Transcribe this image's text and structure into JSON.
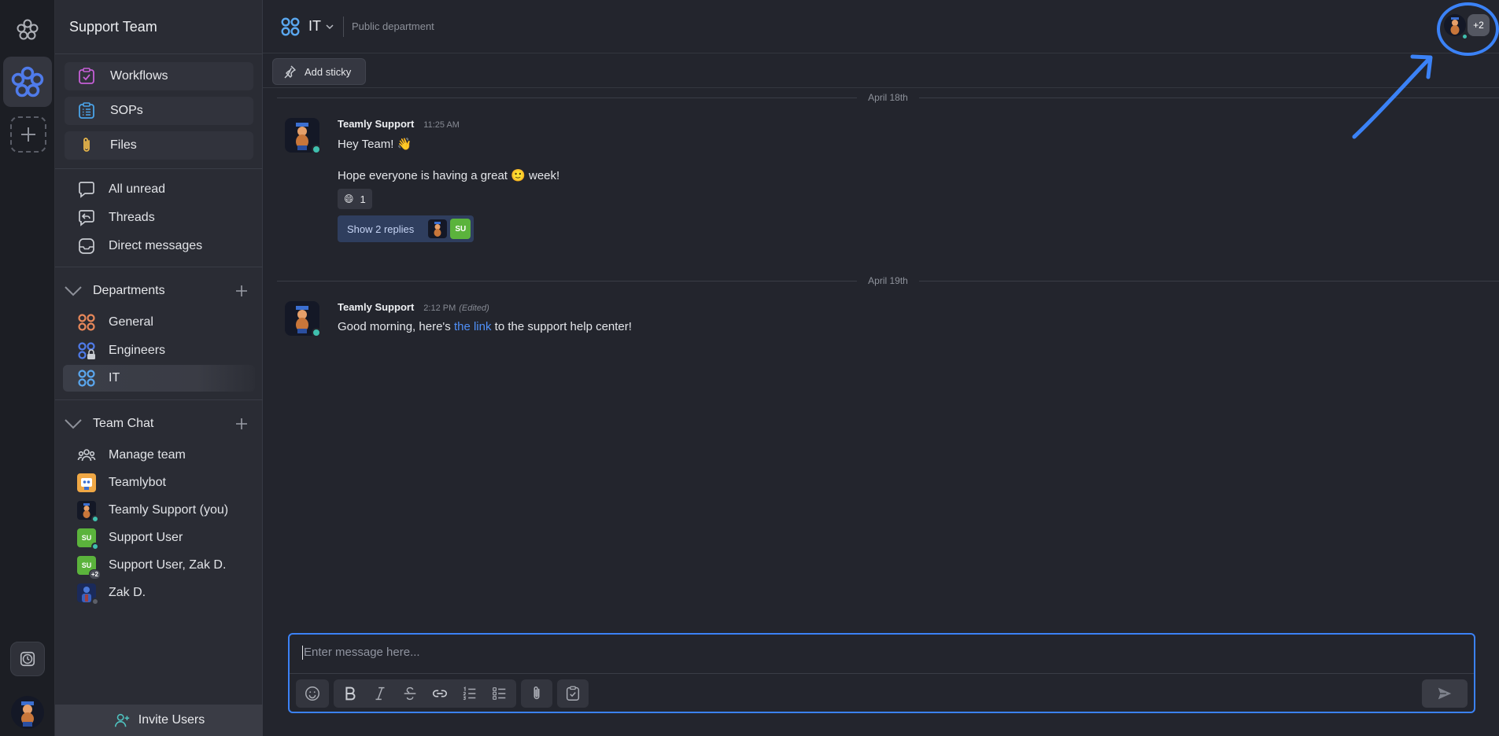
{
  "workspace": {
    "team_name": "Support Team"
  },
  "sidebar": {
    "cards": [
      {
        "label": "Workflows",
        "icon": "workflow-icon"
      },
      {
        "label": "SOPs",
        "icon": "checklist-icon"
      },
      {
        "label": "Files",
        "icon": "paperclip-icon"
      }
    ],
    "nav": [
      {
        "label": "All unread",
        "icon": "chat-bubble-icon"
      },
      {
        "label": "Threads",
        "icon": "thread-icon"
      },
      {
        "label": "Direct messages",
        "icon": "inbox-icon"
      }
    ],
    "departments": {
      "title": "Departments",
      "items": [
        {
          "label": "General",
          "color": "#e8885a"
        },
        {
          "label": "Engineers",
          "color": "#4f7bea"
        },
        {
          "label": "IT",
          "color": "#5aa8f0",
          "active": true
        }
      ]
    },
    "team_chat": {
      "title": "Team Chat",
      "items": [
        {
          "label": "Manage team"
        },
        {
          "label": "Teamlybot"
        },
        {
          "label": "Teamly Support (you)"
        },
        {
          "label": "Support User",
          "initials": "SU"
        },
        {
          "label": "Support User, Zak D.",
          "initials": "SU",
          "badge": "+2"
        },
        {
          "label": "Zak D."
        }
      ]
    },
    "invite_label": "Invite Users"
  },
  "header": {
    "title": "IT",
    "description": "Public department",
    "extra_members": "+2"
  },
  "sticky": {
    "label": "Add sticky"
  },
  "messages": {
    "date1": "April 18th",
    "date2": "April 19th",
    "m1": {
      "author": "Teamly Support",
      "time": "11:25 AM",
      "line1": "Hey Team! 👋",
      "line2_pre": "Hope everyone is having a great ",
      "line2_emoji": "🙂",
      "line2_post": " week!",
      "reaction_emoji": "😄",
      "reaction_count": "1",
      "replies_label": "Show 2 replies",
      "reply_initials": "SU"
    },
    "m2": {
      "author": "Teamly Support",
      "time": "2:12 PM",
      "edited": "(Edited)",
      "pre": "Good morning, here's ",
      "link": "the link",
      "post": " to the support help center!"
    }
  },
  "composer": {
    "placeholder": "Enter message here..."
  },
  "colors": {
    "accent": "#3b82f6",
    "online": "#3fbfae",
    "su_green": "#5bb33c"
  }
}
